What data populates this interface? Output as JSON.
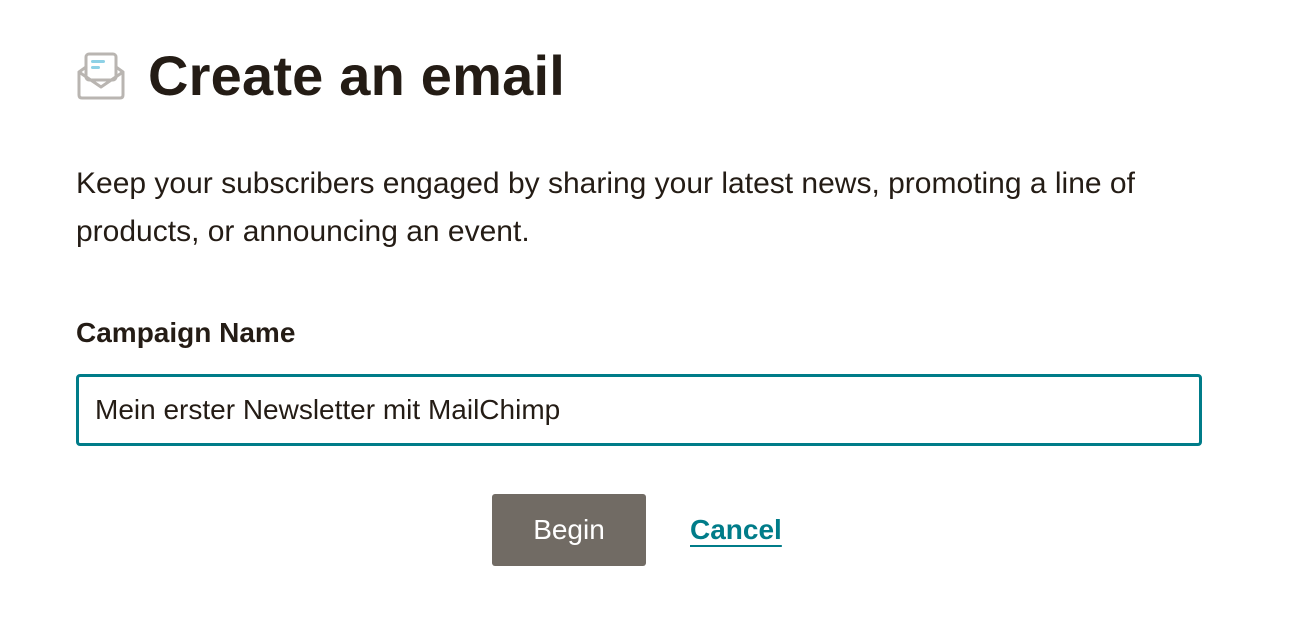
{
  "header": {
    "icon": "open-envelope-icon",
    "title": "Create an email"
  },
  "description": "Keep your subscribers engaged by sharing your latest news, promoting a line of products, or announcing an event.",
  "form": {
    "label": "Campaign Name",
    "value": "Mein erster Newsletter mit MailChimp"
  },
  "actions": {
    "begin_label": "Begin",
    "cancel_label": "Cancel"
  },
  "colors": {
    "accent": "#007c89",
    "button": "#716b64",
    "text": "#241c15",
    "icon_gray": "#b9b5b1",
    "icon_blue": "#8ed1e6"
  }
}
